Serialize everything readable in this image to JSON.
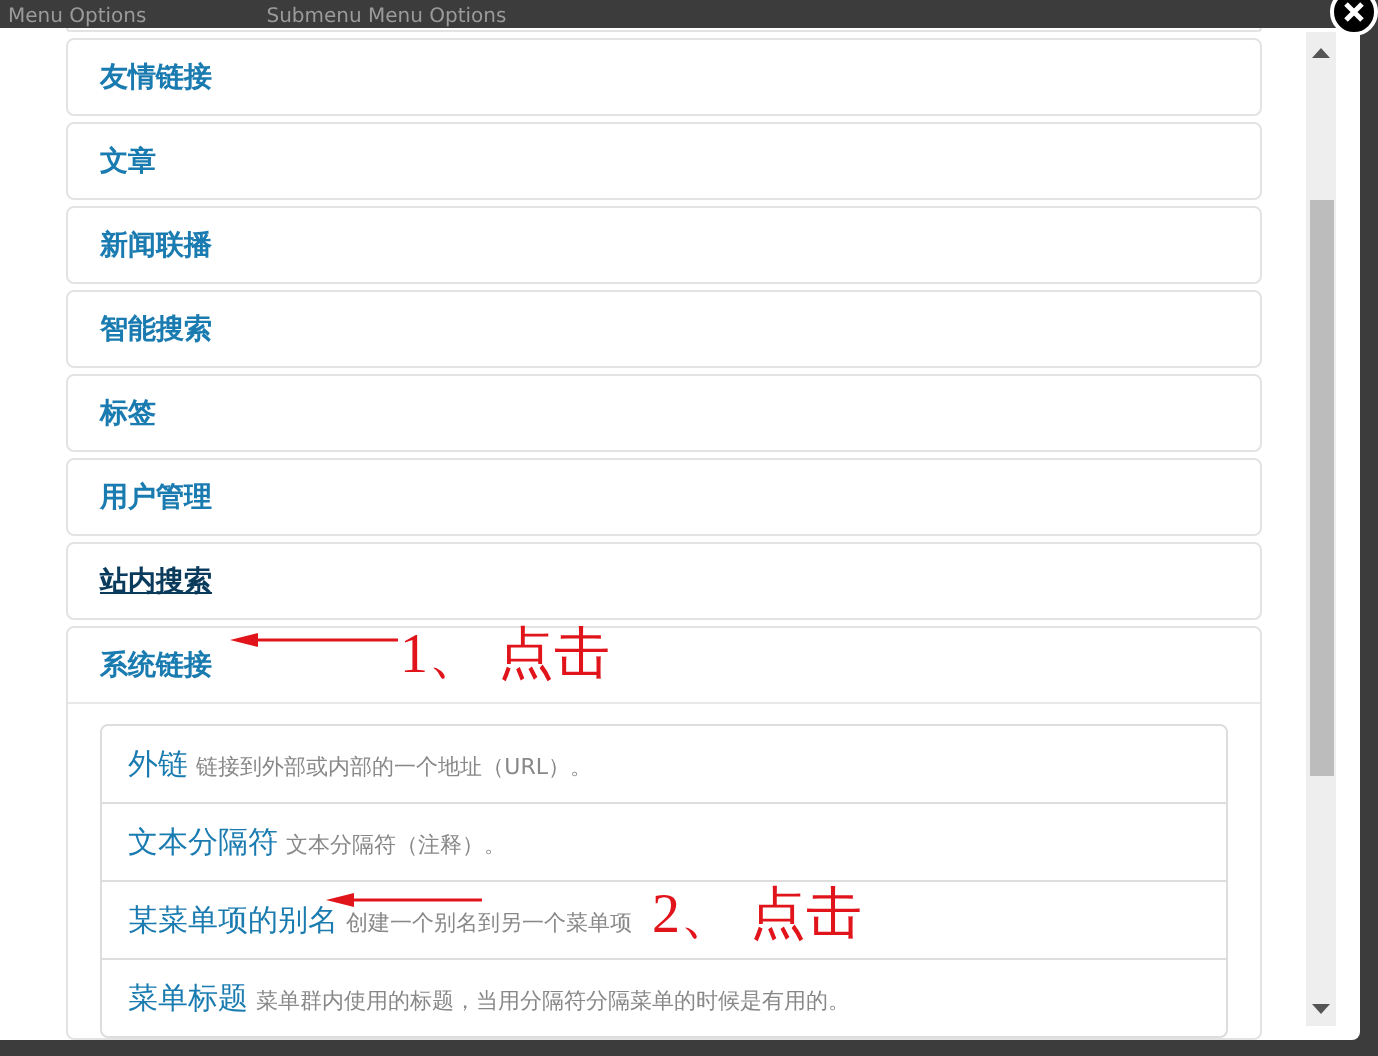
{
  "background_tabs": [
    "Menu Options",
    "Submenu Menu Options"
  ],
  "panels": [
    {
      "title": "友情链接",
      "hovered": false,
      "expanded": false
    },
    {
      "title": "文章",
      "hovered": false,
      "expanded": false
    },
    {
      "title": "新闻联播",
      "hovered": false,
      "expanded": false
    },
    {
      "title": "智能搜索",
      "hovered": false,
      "expanded": false
    },
    {
      "title": "标签",
      "hovered": false,
      "expanded": false
    },
    {
      "title": "用户管理",
      "hovered": false,
      "expanded": false
    },
    {
      "title": "站内搜索",
      "hovered": true,
      "expanded": false
    },
    {
      "title": "系统链接",
      "hovered": false,
      "expanded": true,
      "items": [
        {
          "name": "外链",
          "description": "链接到外部或内部的一个地址（URL）。"
        },
        {
          "name": "文本分隔符",
          "description": "文本分隔符（注释）。"
        },
        {
          "name": "某菜单项的别名",
          "description": "创建一个别名到另一个菜单项"
        },
        {
          "name": "菜单标题",
          "description": "菜单群内使用的标题，当用分隔符分隔菜单的时候是有用的。"
        }
      ]
    }
  ],
  "annotations": [
    {
      "text": "1、 点击"
    },
    {
      "text": "2、 点击"
    }
  ]
}
